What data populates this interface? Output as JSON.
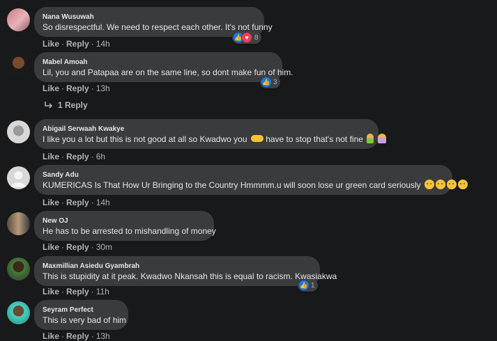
{
  "actions": {
    "like": "Like",
    "reply": "Reply",
    "sep": "·"
  },
  "comments": [
    {
      "name": "Nana Wusuwah",
      "text": "So disrespectful. We need to respect each other. It's not funny",
      "time": "14h",
      "reactions": "8"
    },
    {
      "name": "Mabel Amoah",
      "text": "Lil, you and Patapaa are on the same line, so dont make fun of him.",
      "time": "13h",
      "reactions": "3",
      "replies": "1 Reply"
    },
    {
      "name": "Abigail Serwaah Kwakye",
      "text_a": "I like you a lot but this is not good at all so Kwadwo you",
      "text_b": "have to stop that's not fine",
      "time": "6h"
    },
    {
      "name": "Sandy Adu",
      "text": "KUMERICAS Is That How Ur Bringing to the Country Hmmmm.u will soon lose ur green card seriously",
      "time": "14h"
    },
    {
      "name": "New OJ",
      "text": "He has to be arrested to mishandling of money",
      "time": "30m"
    },
    {
      "name": "Maxmillian Asiedu Gyambrah",
      "text": "This is stupidity at it peak. Kwadwo Nkansah this is equal to racism. Kwasiakwa",
      "time": "11h",
      "reactions": "1"
    },
    {
      "name": "Seyram Perfect",
      "text": "This is very bad of him",
      "time": "13h"
    }
  ],
  "icons": {
    "like": "thumbs-up-icon",
    "love": "heart-icon",
    "reply_arrow": "reply-arrow-icon"
  },
  "colors": {
    "background": "#18191a",
    "bubble": "#3a3b3c",
    "like_blue": "#1877f2",
    "love_red": "#f33e58"
  }
}
